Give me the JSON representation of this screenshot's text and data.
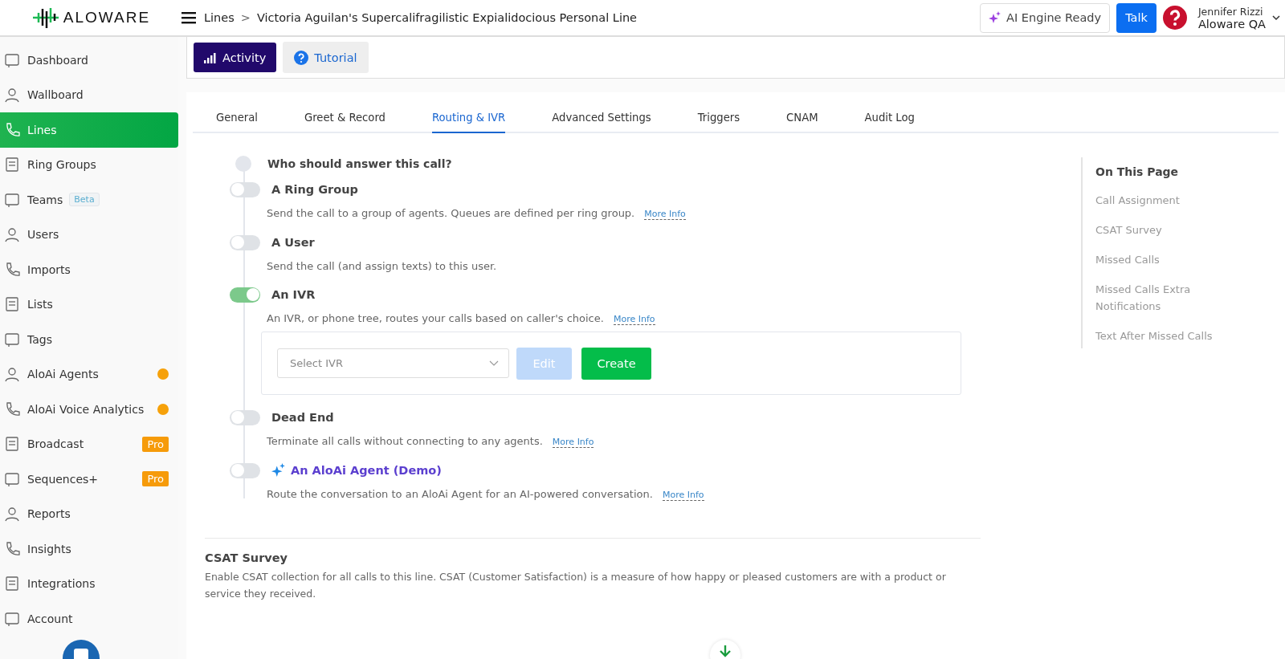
{
  "brand": {
    "name": "ALOWARE"
  },
  "header": {
    "breadcrumb": [
      "Lines",
      "Victoria Aguilan's Supercalifragilistic Expialidocious Personal Line"
    ],
    "separator": ">",
    "ai_status": "AI Engine Ready",
    "talk": "Talk",
    "user_name": "Jennifer Rizzi",
    "account": "Aloware QA"
  },
  "sidebar": {
    "items": [
      {
        "label": "Dashboard",
        "selected": false
      },
      {
        "label": "Wallboard",
        "selected": false
      },
      {
        "label": "Lines",
        "selected": true
      },
      {
        "label": "Ring Groups",
        "selected": false
      },
      {
        "label": "Teams",
        "selected": false,
        "badge": {
          "kind": "beta",
          "text": "Beta"
        }
      },
      {
        "label": "Users",
        "selected": false
      },
      {
        "label": "Imports",
        "selected": false
      },
      {
        "label": "Lists",
        "selected": false
      },
      {
        "label": "Tags",
        "selected": false
      },
      {
        "label": "AloAi Agents",
        "selected": false,
        "badge": {
          "kind": "dot",
          "color": "#f6a10a"
        }
      },
      {
        "label": "AloAi Voice Analytics",
        "selected": false,
        "badge": {
          "kind": "dot",
          "color": "#f6a10a"
        }
      },
      {
        "label": "Broadcast",
        "selected": false,
        "badge": {
          "kind": "pro",
          "text": "Pro"
        }
      },
      {
        "label": "Sequences+",
        "selected": false,
        "badge": {
          "kind": "pro",
          "text": "Pro"
        }
      },
      {
        "label": "Reports",
        "selected": false
      },
      {
        "label": "Insights",
        "selected": false
      },
      {
        "label": "Integrations",
        "selected": false
      },
      {
        "label": "Account",
        "selected": false
      }
    ]
  },
  "actions": [
    {
      "label": "Activity",
      "kind": "primary"
    },
    {
      "label": "Tutorial",
      "kind": "help"
    }
  ],
  "tabs": [
    {
      "label": "General",
      "selected": false
    },
    {
      "label": "Greet & Record",
      "selected": false
    },
    {
      "label": "Routing & IVR",
      "selected": true
    },
    {
      "label": "Advanced Settings",
      "selected": false
    },
    {
      "label": "Triggers",
      "selected": false
    },
    {
      "label": "CNAM",
      "selected": false
    },
    {
      "label": "Audit Log",
      "selected": false
    }
  ],
  "routing": {
    "question": "Who should answer this call?",
    "options": [
      {
        "kind": "plain",
        "title": "A Ring Group",
        "on": false,
        "description": "Send the call to a group of agents. Queues are defined per ring group.",
        "more_info": "More Info"
      },
      {
        "kind": "plain",
        "title": "A User",
        "on": false,
        "description": "Send the call (and assign texts) to this user."
      },
      {
        "kind": "ivr",
        "title": "An IVR",
        "on": true,
        "description": "An IVR, or phone tree, routes your calls based on caller's choice.",
        "more_info": "More Info",
        "select_placeholder": "Select IVR",
        "edit": {
          "label": "Edit",
          "disabled": true
        },
        "create": "Create"
      },
      {
        "kind": "plain",
        "title": "Dead End",
        "on": false,
        "description": "Terminate all calls without connecting to any agents.",
        "more_info": "More Info"
      },
      {
        "kind": "ai",
        "title": "An AloAi Agent (Demo)",
        "on": false,
        "description": "Route the conversation to an AloAi Agent for an AI-powered conversation.",
        "more_info": "More Info"
      }
    ]
  },
  "csat": {
    "title": "CSAT Survey",
    "description": "Enable CSAT collection for all calls to this line. CSAT (Customer Satisfaction) is a measure of how happy or pleased customers are with a product or service they received."
  },
  "on_this_page": {
    "title": "On This Page",
    "items": [
      "Call Assignment",
      "CSAT Survey",
      "Missed Calls",
      "Missed Calls Extra Notifications",
      "Text After Missed Calls"
    ]
  }
}
